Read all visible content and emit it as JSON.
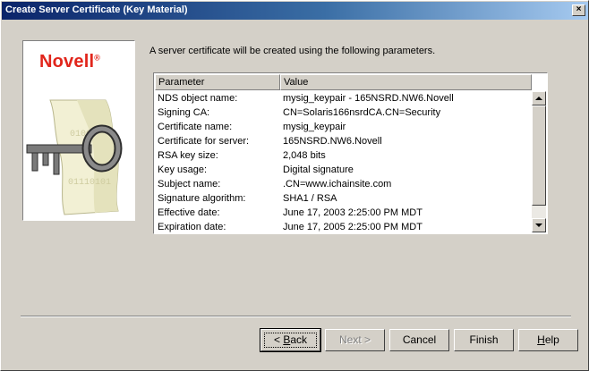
{
  "window": {
    "title": "Create Server Certificate (Key Material)",
    "close_glyph": "×"
  },
  "logo": {
    "brand": "Novell",
    "mark": "®"
  },
  "intro": "A server certificate will be created using the following parameters.",
  "table": {
    "columns": [
      "Parameter",
      "Value"
    ],
    "rows": [
      {
        "param": "NDS object name:",
        "value": "mysig_keypair - 165NSRD.NW6.Novell"
      },
      {
        "param": "Signing CA:",
        "value": "CN=Solaris166nsrdCA.CN=Security"
      },
      {
        "param": "Certificate name:",
        "value": "mysig_keypair"
      },
      {
        "param": "Certificate for server:",
        "value": "165NSRD.NW6.Novell"
      },
      {
        "param": "RSA key size:",
        "value": "2,048 bits"
      },
      {
        "param": "Key usage:",
        "value": "Digital signature"
      },
      {
        "param": "Subject name:",
        "value": ".CN=www.ichainsite.com"
      },
      {
        "param": "Signature algorithm:",
        "value": "SHA1 / RSA"
      },
      {
        "param": "Effective date:",
        "value": "June 17, 2003 2:25:00 PM MDT"
      },
      {
        "param": "Expiration date:",
        "value": "June 17, 2005 2:25:00 PM MDT"
      }
    ]
  },
  "buttons": {
    "back": {
      "pre": "< ",
      "key": "B",
      "rest": "ack"
    },
    "next": "Next >",
    "cancel": "Cancel",
    "finish": "Finish",
    "help": {
      "key": "H",
      "rest": "elp"
    }
  },
  "icons": {
    "close": "close-icon",
    "scroll_up": "arrow-up-icon",
    "scroll_down": "arrow-down-icon",
    "certificate": "certificate-key-icon"
  },
  "colors": {
    "title_bar": "#0a246a",
    "brand": "#e1251b",
    "dialog_bg": "#d4d0c8"
  }
}
